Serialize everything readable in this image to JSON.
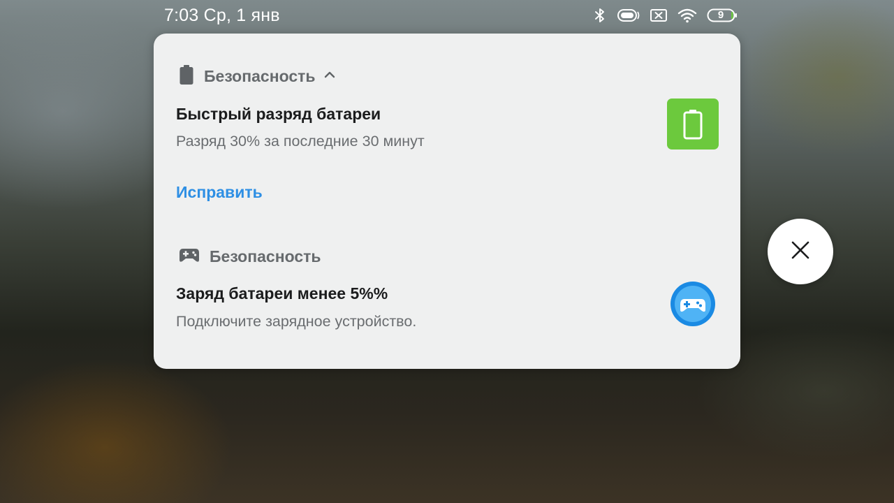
{
  "status_bar": {
    "time_date": "7:03 Ср, 1 янв",
    "battery_level": "9",
    "icons": [
      "bluetooth-icon",
      "vibrate-icon",
      "no-sim-icon",
      "wifi-icon",
      "battery-icon"
    ]
  },
  "notifications": [
    {
      "app_name": "Безопасность",
      "app_icon": "battery-icon",
      "expand_icon": "chevron-up-icon",
      "title": "Быстрый разряд батареи",
      "body": "Разряд 30% за последние 30 минут",
      "action_label": "Исправить",
      "large_icon": "battery-icon",
      "large_icon_color": "#6cc93d"
    },
    {
      "app_name": "Безопасность",
      "app_icon": "gamepad-icon",
      "title": "Заряд батареи менее 5%%",
      "body": "Подключите зарядное устройство.",
      "large_icon": "gamepad-icon",
      "large_icon_color": "#1a8ae3"
    }
  ],
  "close_button": {
    "icon": "close-icon"
  },
  "colors": {
    "panel_bg": "#eff0f0",
    "action_blue": "#2e8fe4",
    "title_text": "#1b1c1d",
    "secondary_text": "#6a6d70"
  }
}
